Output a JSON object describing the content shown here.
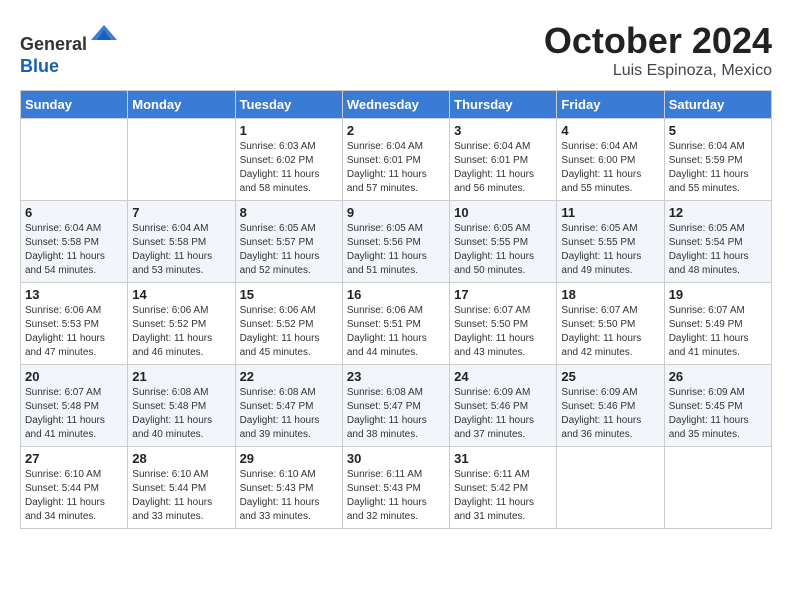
{
  "header": {
    "logo_line1": "General",
    "logo_line2": "Blue",
    "month": "October 2024",
    "location": "Luis Espinoza, Mexico"
  },
  "days_of_week": [
    "Sunday",
    "Monday",
    "Tuesday",
    "Wednesday",
    "Thursday",
    "Friday",
    "Saturday"
  ],
  "weeks": [
    [
      {
        "day": "",
        "info": ""
      },
      {
        "day": "",
        "info": ""
      },
      {
        "day": "1",
        "info": "Sunrise: 6:03 AM\nSunset: 6:02 PM\nDaylight: 11 hours and 58 minutes."
      },
      {
        "day": "2",
        "info": "Sunrise: 6:04 AM\nSunset: 6:01 PM\nDaylight: 11 hours and 57 minutes."
      },
      {
        "day": "3",
        "info": "Sunrise: 6:04 AM\nSunset: 6:01 PM\nDaylight: 11 hours and 56 minutes."
      },
      {
        "day": "4",
        "info": "Sunrise: 6:04 AM\nSunset: 6:00 PM\nDaylight: 11 hours and 55 minutes."
      },
      {
        "day": "5",
        "info": "Sunrise: 6:04 AM\nSunset: 5:59 PM\nDaylight: 11 hours and 55 minutes."
      }
    ],
    [
      {
        "day": "6",
        "info": "Sunrise: 6:04 AM\nSunset: 5:58 PM\nDaylight: 11 hours and 54 minutes."
      },
      {
        "day": "7",
        "info": "Sunrise: 6:04 AM\nSunset: 5:58 PM\nDaylight: 11 hours and 53 minutes."
      },
      {
        "day": "8",
        "info": "Sunrise: 6:05 AM\nSunset: 5:57 PM\nDaylight: 11 hours and 52 minutes."
      },
      {
        "day": "9",
        "info": "Sunrise: 6:05 AM\nSunset: 5:56 PM\nDaylight: 11 hours and 51 minutes."
      },
      {
        "day": "10",
        "info": "Sunrise: 6:05 AM\nSunset: 5:55 PM\nDaylight: 11 hours and 50 minutes."
      },
      {
        "day": "11",
        "info": "Sunrise: 6:05 AM\nSunset: 5:55 PM\nDaylight: 11 hours and 49 minutes."
      },
      {
        "day": "12",
        "info": "Sunrise: 6:05 AM\nSunset: 5:54 PM\nDaylight: 11 hours and 48 minutes."
      }
    ],
    [
      {
        "day": "13",
        "info": "Sunrise: 6:06 AM\nSunset: 5:53 PM\nDaylight: 11 hours and 47 minutes."
      },
      {
        "day": "14",
        "info": "Sunrise: 6:06 AM\nSunset: 5:52 PM\nDaylight: 11 hours and 46 minutes."
      },
      {
        "day": "15",
        "info": "Sunrise: 6:06 AM\nSunset: 5:52 PM\nDaylight: 11 hours and 45 minutes."
      },
      {
        "day": "16",
        "info": "Sunrise: 6:06 AM\nSunset: 5:51 PM\nDaylight: 11 hours and 44 minutes."
      },
      {
        "day": "17",
        "info": "Sunrise: 6:07 AM\nSunset: 5:50 PM\nDaylight: 11 hours and 43 minutes."
      },
      {
        "day": "18",
        "info": "Sunrise: 6:07 AM\nSunset: 5:50 PM\nDaylight: 11 hours and 42 minutes."
      },
      {
        "day": "19",
        "info": "Sunrise: 6:07 AM\nSunset: 5:49 PM\nDaylight: 11 hours and 41 minutes."
      }
    ],
    [
      {
        "day": "20",
        "info": "Sunrise: 6:07 AM\nSunset: 5:48 PM\nDaylight: 11 hours and 41 minutes."
      },
      {
        "day": "21",
        "info": "Sunrise: 6:08 AM\nSunset: 5:48 PM\nDaylight: 11 hours and 40 minutes."
      },
      {
        "day": "22",
        "info": "Sunrise: 6:08 AM\nSunset: 5:47 PM\nDaylight: 11 hours and 39 minutes."
      },
      {
        "day": "23",
        "info": "Sunrise: 6:08 AM\nSunset: 5:47 PM\nDaylight: 11 hours and 38 minutes."
      },
      {
        "day": "24",
        "info": "Sunrise: 6:09 AM\nSunset: 5:46 PM\nDaylight: 11 hours and 37 minutes."
      },
      {
        "day": "25",
        "info": "Sunrise: 6:09 AM\nSunset: 5:46 PM\nDaylight: 11 hours and 36 minutes."
      },
      {
        "day": "26",
        "info": "Sunrise: 6:09 AM\nSunset: 5:45 PM\nDaylight: 11 hours and 35 minutes."
      }
    ],
    [
      {
        "day": "27",
        "info": "Sunrise: 6:10 AM\nSunset: 5:44 PM\nDaylight: 11 hours and 34 minutes."
      },
      {
        "day": "28",
        "info": "Sunrise: 6:10 AM\nSunset: 5:44 PM\nDaylight: 11 hours and 33 minutes."
      },
      {
        "day": "29",
        "info": "Sunrise: 6:10 AM\nSunset: 5:43 PM\nDaylight: 11 hours and 33 minutes."
      },
      {
        "day": "30",
        "info": "Sunrise: 6:11 AM\nSunset: 5:43 PM\nDaylight: 11 hours and 32 minutes."
      },
      {
        "day": "31",
        "info": "Sunrise: 6:11 AM\nSunset: 5:42 PM\nDaylight: 11 hours and 31 minutes."
      },
      {
        "day": "",
        "info": ""
      },
      {
        "day": "",
        "info": ""
      }
    ]
  ]
}
